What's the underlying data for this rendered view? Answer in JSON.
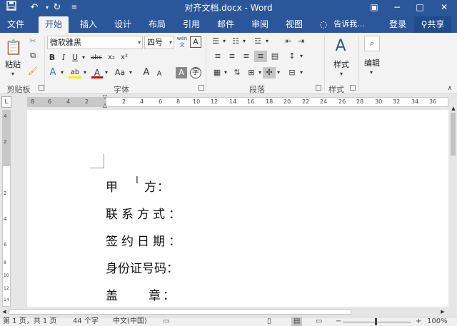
{
  "titlebar": {
    "title": "对齐文档.docx - Word",
    "save_icon": "save-icon",
    "undo_icon": "undo-icon",
    "redo_icon": "redo-icon",
    "minimize": "−",
    "restore": "□",
    "close": "✕",
    "ribbon_display": "▣"
  },
  "tabs": [
    "文件",
    "开始",
    "插入",
    "设计",
    "布局",
    "引用",
    "邮件",
    "审阅",
    "视图"
  ],
  "active_tab": "开始",
  "tell_me": "告诉我...",
  "login": "登录",
  "share": "共享",
  "ribbon": {
    "clipboard": {
      "paste": "粘贴",
      "label": "剪贴板"
    },
    "font": {
      "name": "微软雅黑",
      "size": "四号",
      "wen": "wén\n文",
      "label": "字体",
      "bold": "B",
      "italic": "I",
      "underline": "U",
      "strike": "abc",
      "sub": "x₂",
      "sup": "x²",
      "grow": "A",
      "shrink": "A",
      "aa": "Aa",
      "clear": "A",
      "highlight": "ab",
      "fontcolor": "A"
    },
    "paragraph": {
      "label": "段落"
    },
    "styles": {
      "big": "样式",
      "label": "样式"
    },
    "editing": {
      "big": "编辑"
    }
  },
  "ruler": {
    "h_ticks": [
      "8",
      "6",
      "4",
      "2",
      "2",
      "4",
      "6",
      "8",
      "10",
      "12",
      "14",
      "16",
      "18",
      "20",
      "22",
      "24",
      "26",
      "28",
      "30",
      "32",
      "34",
      "36"
    ],
    "v_ticks": [
      "4",
      "2",
      "2",
      "4",
      "6",
      "8",
      "10",
      "12",
      "14"
    ]
  },
  "document": {
    "lines": [
      "甲　　方：",
      "联系方式：",
      "签约日期：",
      "身份证号码：",
      "盖　　章："
    ]
  },
  "status": {
    "pages": "第 1 页，共 1 页",
    "words": "44 个字",
    "lang": "中文(中国)",
    "zoom": "100%"
  }
}
